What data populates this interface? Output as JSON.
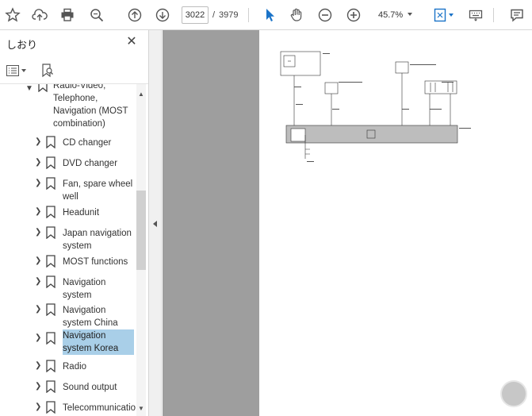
{
  "toolbar": {
    "page_current": "3022",
    "page_separator": "/",
    "page_total": "3979",
    "zoom": "45.7%",
    "icons": [
      "star-icon",
      "cloud-upload-icon",
      "print-icon",
      "zoom-search-icon",
      "page-up-icon",
      "page-down-icon",
      "select-cursor-icon",
      "hand-icon",
      "zoom-out-icon",
      "zoom-in-icon",
      "fit-page-icon",
      "keyboard-icon",
      "comment-icon"
    ]
  },
  "sidebar": {
    "title": "しおり",
    "items": [
      {
        "label": "Radio-Video, Telephone, Navigation (MOST combination)",
        "expanded": true
      },
      {
        "label": "CD changer"
      },
      {
        "label": "DVD changer"
      },
      {
        "label": "Fan, spare wheel well"
      },
      {
        "label": "Headunit"
      },
      {
        "label": "Japan navigation system"
      },
      {
        "label": "MOST functions"
      },
      {
        "label": "Navigation system"
      },
      {
        "label": "Navigation system China"
      },
      {
        "label": "Navigation system Korea",
        "selected": true
      },
      {
        "label": "Radio"
      },
      {
        "label": "Sound output"
      },
      {
        "label": "Telecommunication"
      }
    ]
  },
  "colors": {
    "selection": "#a9cfe8",
    "doc_background": "#9e9e9e",
    "accent_blue": "#1a73c8"
  }
}
